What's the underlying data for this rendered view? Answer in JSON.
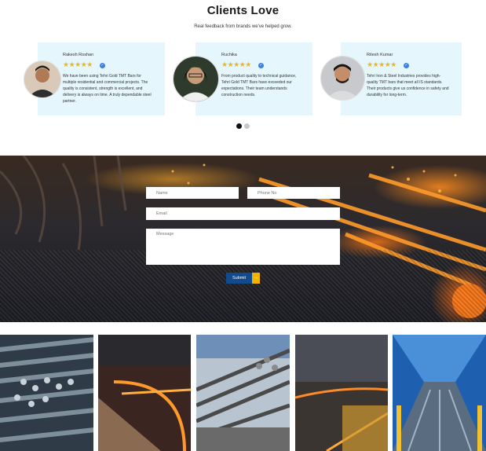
{
  "testimonials": {
    "title": "Clients Love",
    "subtitle": "Real feedback from brands we've helped grow.",
    "cards": [
      {
        "name": "Rakesh Roshan",
        "stars": "★★★★★",
        "verified": "✓",
        "lines": [
          "We have been using Tehri Gold TMT Bars for",
          "multiple residential and commercial projects. The",
          "quality is consistent, strength is excellent, and",
          "delivery is always on time. A truly dependable steel",
          "partner."
        ]
      },
      {
        "name": "Ruchika",
        "stars": "★★★★★",
        "verified": "✓",
        "lines": [
          "From product quality to technical guidance,",
          "Tehri Gold TMT Bars have exceeded our",
          "expectations. Their team understands",
          "construction needs."
        ]
      },
      {
        "name": "Ritesh Kumar",
        "stars": "★★★★★",
        "verified": "✓",
        "lines": [
          "Tehri Iron & Steel Industries provides high-",
          "quality TMT bars that meet all IS standards.",
          "Their products give us confidence in safety and",
          "durability for long-term."
        ]
      }
    ],
    "pagination": {
      "active": 1,
      "total": 2
    }
  },
  "form": {
    "name_placeholder": "Name",
    "phone_placeholder": "Phone No",
    "email_placeholder": "Email",
    "message_placeholder": "Message",
    "submit_label": "Submit",
    "arrow_icon": "→"
  },
  "colors": {
    "accent": "#124a8e",
    "arrow": "#f0b400",
    "card_bg": "#e6f6fd",
    "star": "#f5b50a"
  }
}
